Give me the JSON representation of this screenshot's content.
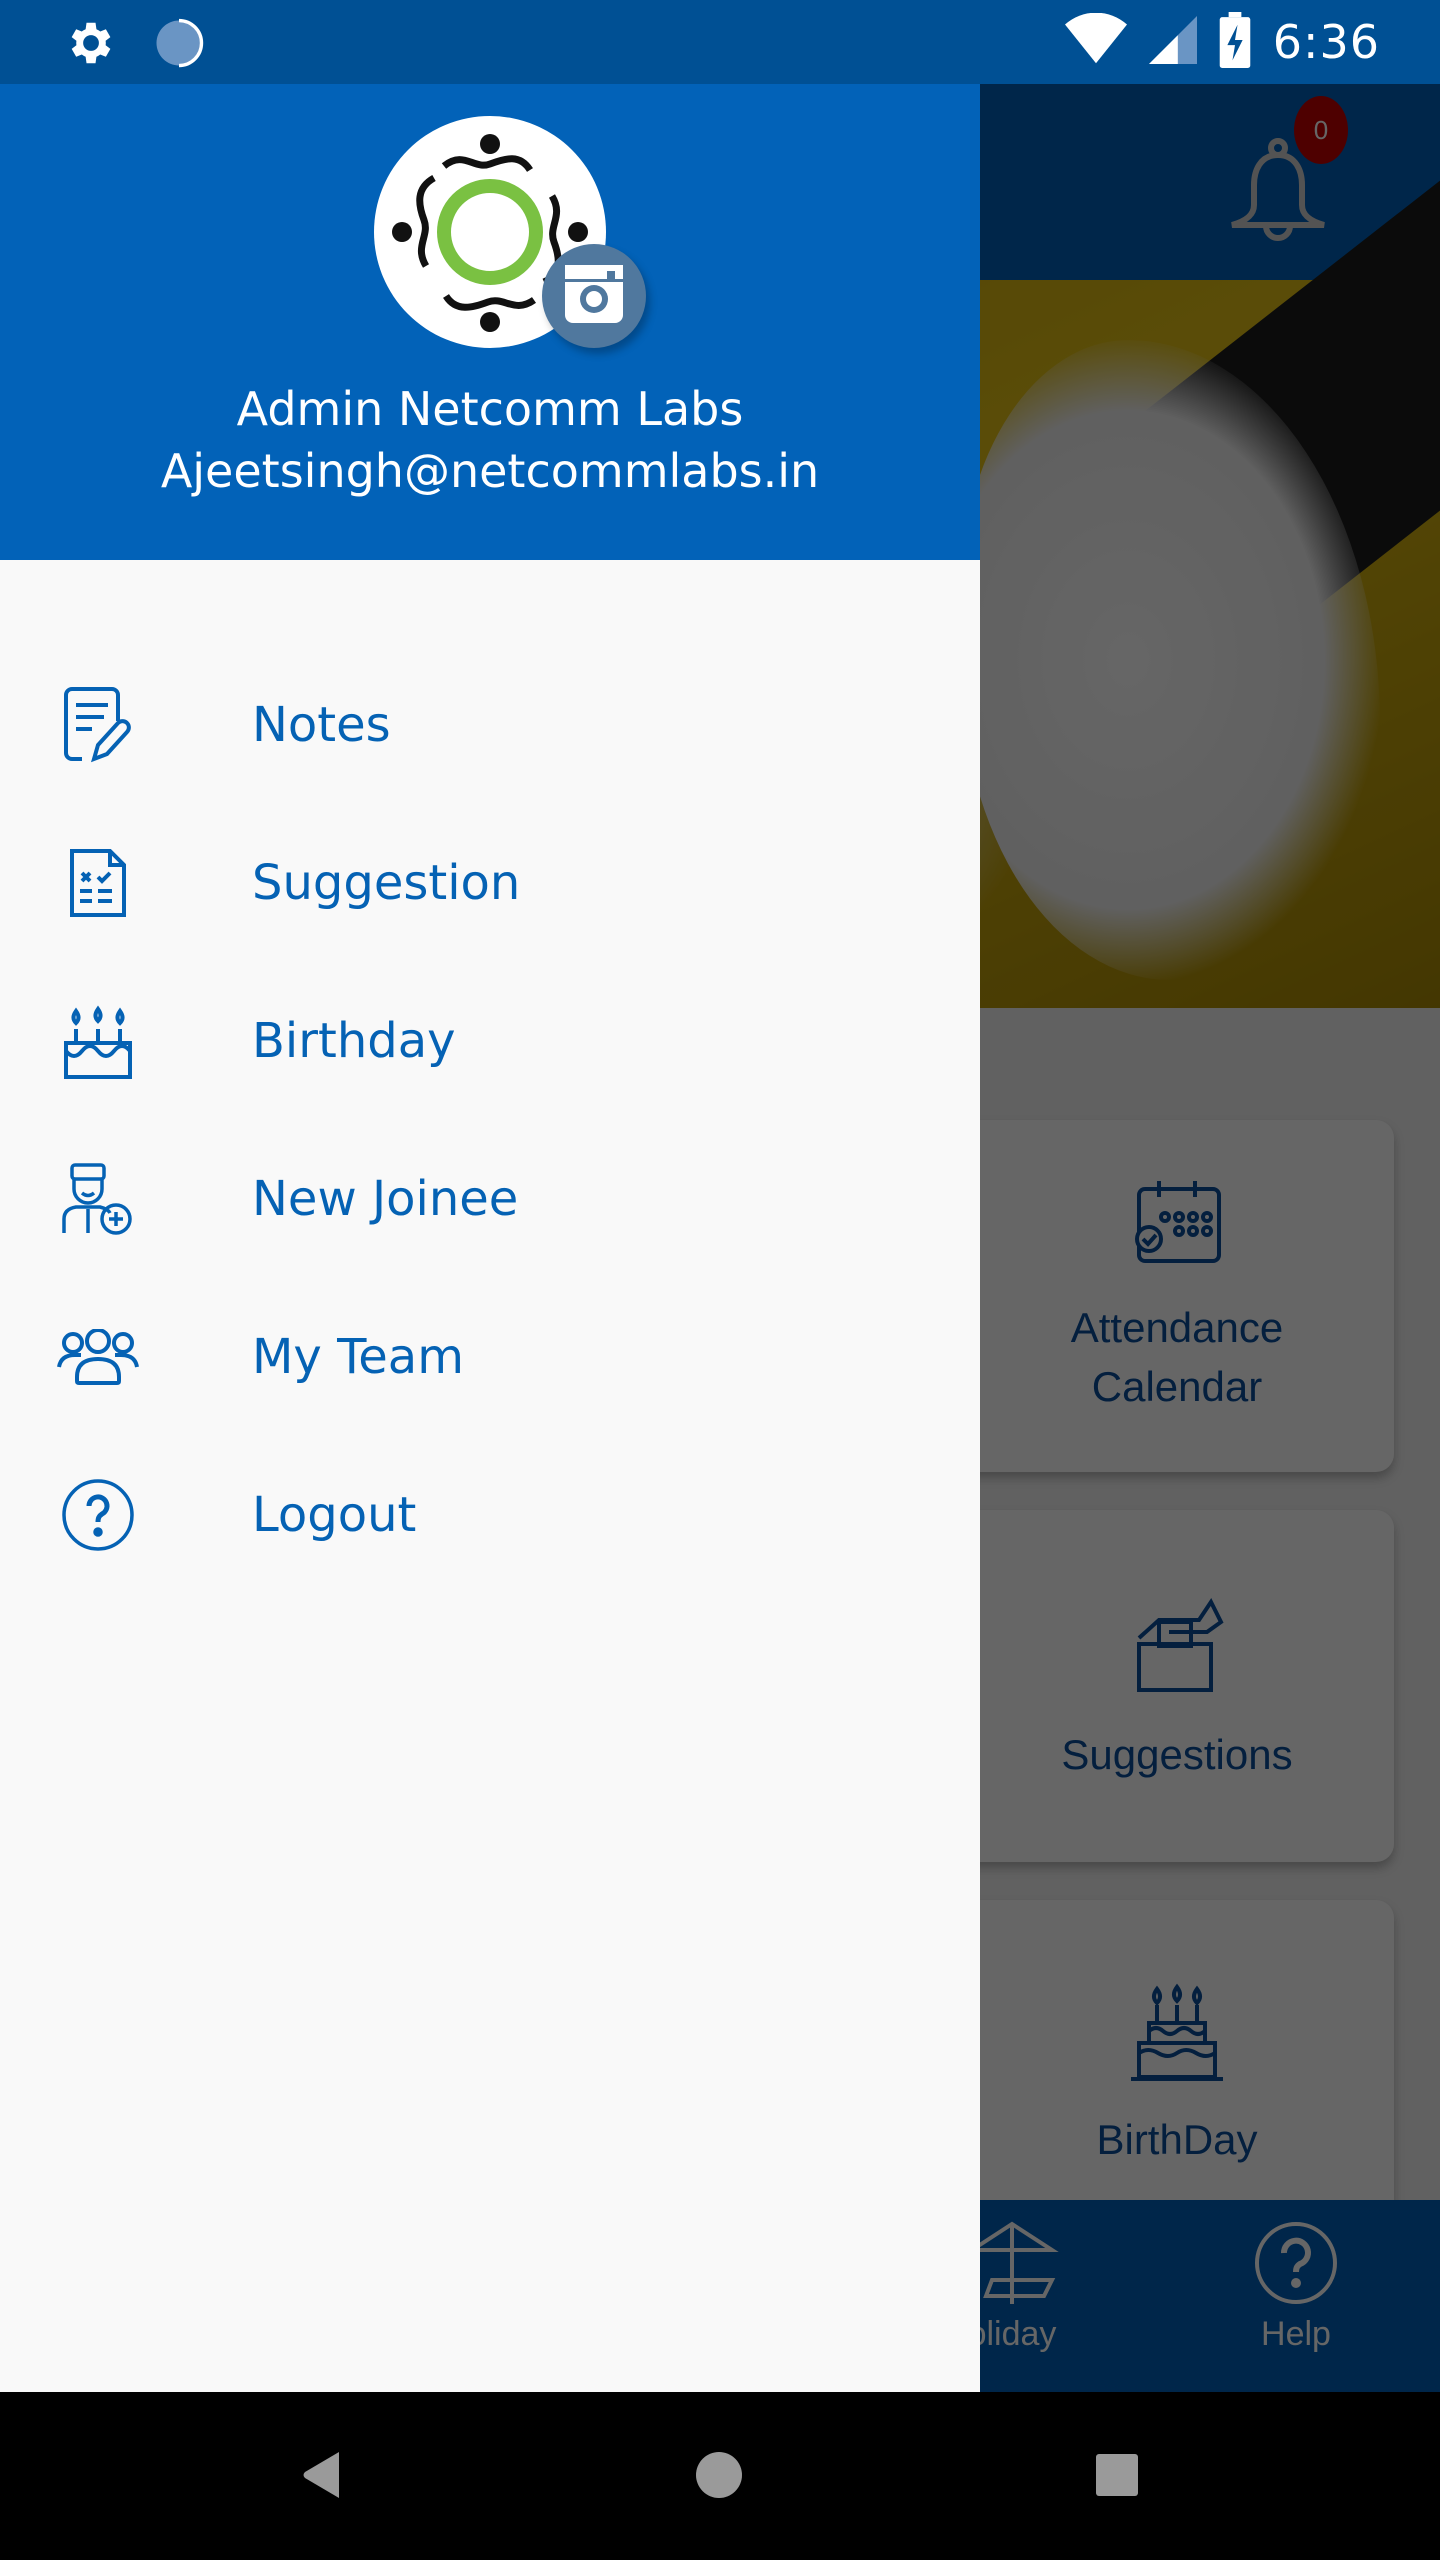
{
  "status_bar": {
    "time": "6:36",
    "left_icons": [
      "settings-icon",
      "sync-icon"
    ],
    "right_icons": [
      "wifi-icon",
      "cell-signal-icon",
      "battery-charging-icon"
    ]
  },
  "background_app": {
    "notification_count": "0",
    "cards": [
      {
        "label": "Attendance\nCalendar",
        "line1": "Attendance",
        "line2": "Calendar",
        "icon": "calendar-check-icon"
      },
      {
        "label": "Suggestions",
        "icon": "ballot-box-icon"
      },
      {
        "label": "BirthDay",
        "icon": "cake-icon"
      }
    ],
    "bottom_nav": [
      {
        "label": "Holiday",
        "visible_label": "oliday",
        "icon": "beach-umbrella-icon"
      },
      {
        "label": "Help",
        "icon": "help-icon"
      }
    ]
  },
  "drawer": {
    "user": {
      "name": "Admin Netcomm Labs",
      "email": "Ajeetsingh@netcommlabs.in"
    },
    "menu_items": [
      {
        "label": "Notes",
        "icon": "notes-icon"
      },
      {
        "label": "Suggestion",
        "icon": "checklist-icon"
      },
      {
        "label": "Birthday",
        "icon": "cake-icon"
      },
      {
        "label": "New Joinee",
        "icon": "new-user-icon"
      },
      {
        "label": "My Team",
        "icon": "team-icon"
      },
      {
        "label": "Logout",
        "icon": "help-icon"
      }
    ]
  },
  "nav_bar": {
    "buttons": [
      "back",
      "home",
      "recents"
    ]
  },
  "colors": {
    "primary": "#0262b8",
    "status_bar": "#005094",
    "menu_text": "#0562b4",
    "badge": "#c40000",
    "drawer_bg": "#f9f9f9"
  }
}
